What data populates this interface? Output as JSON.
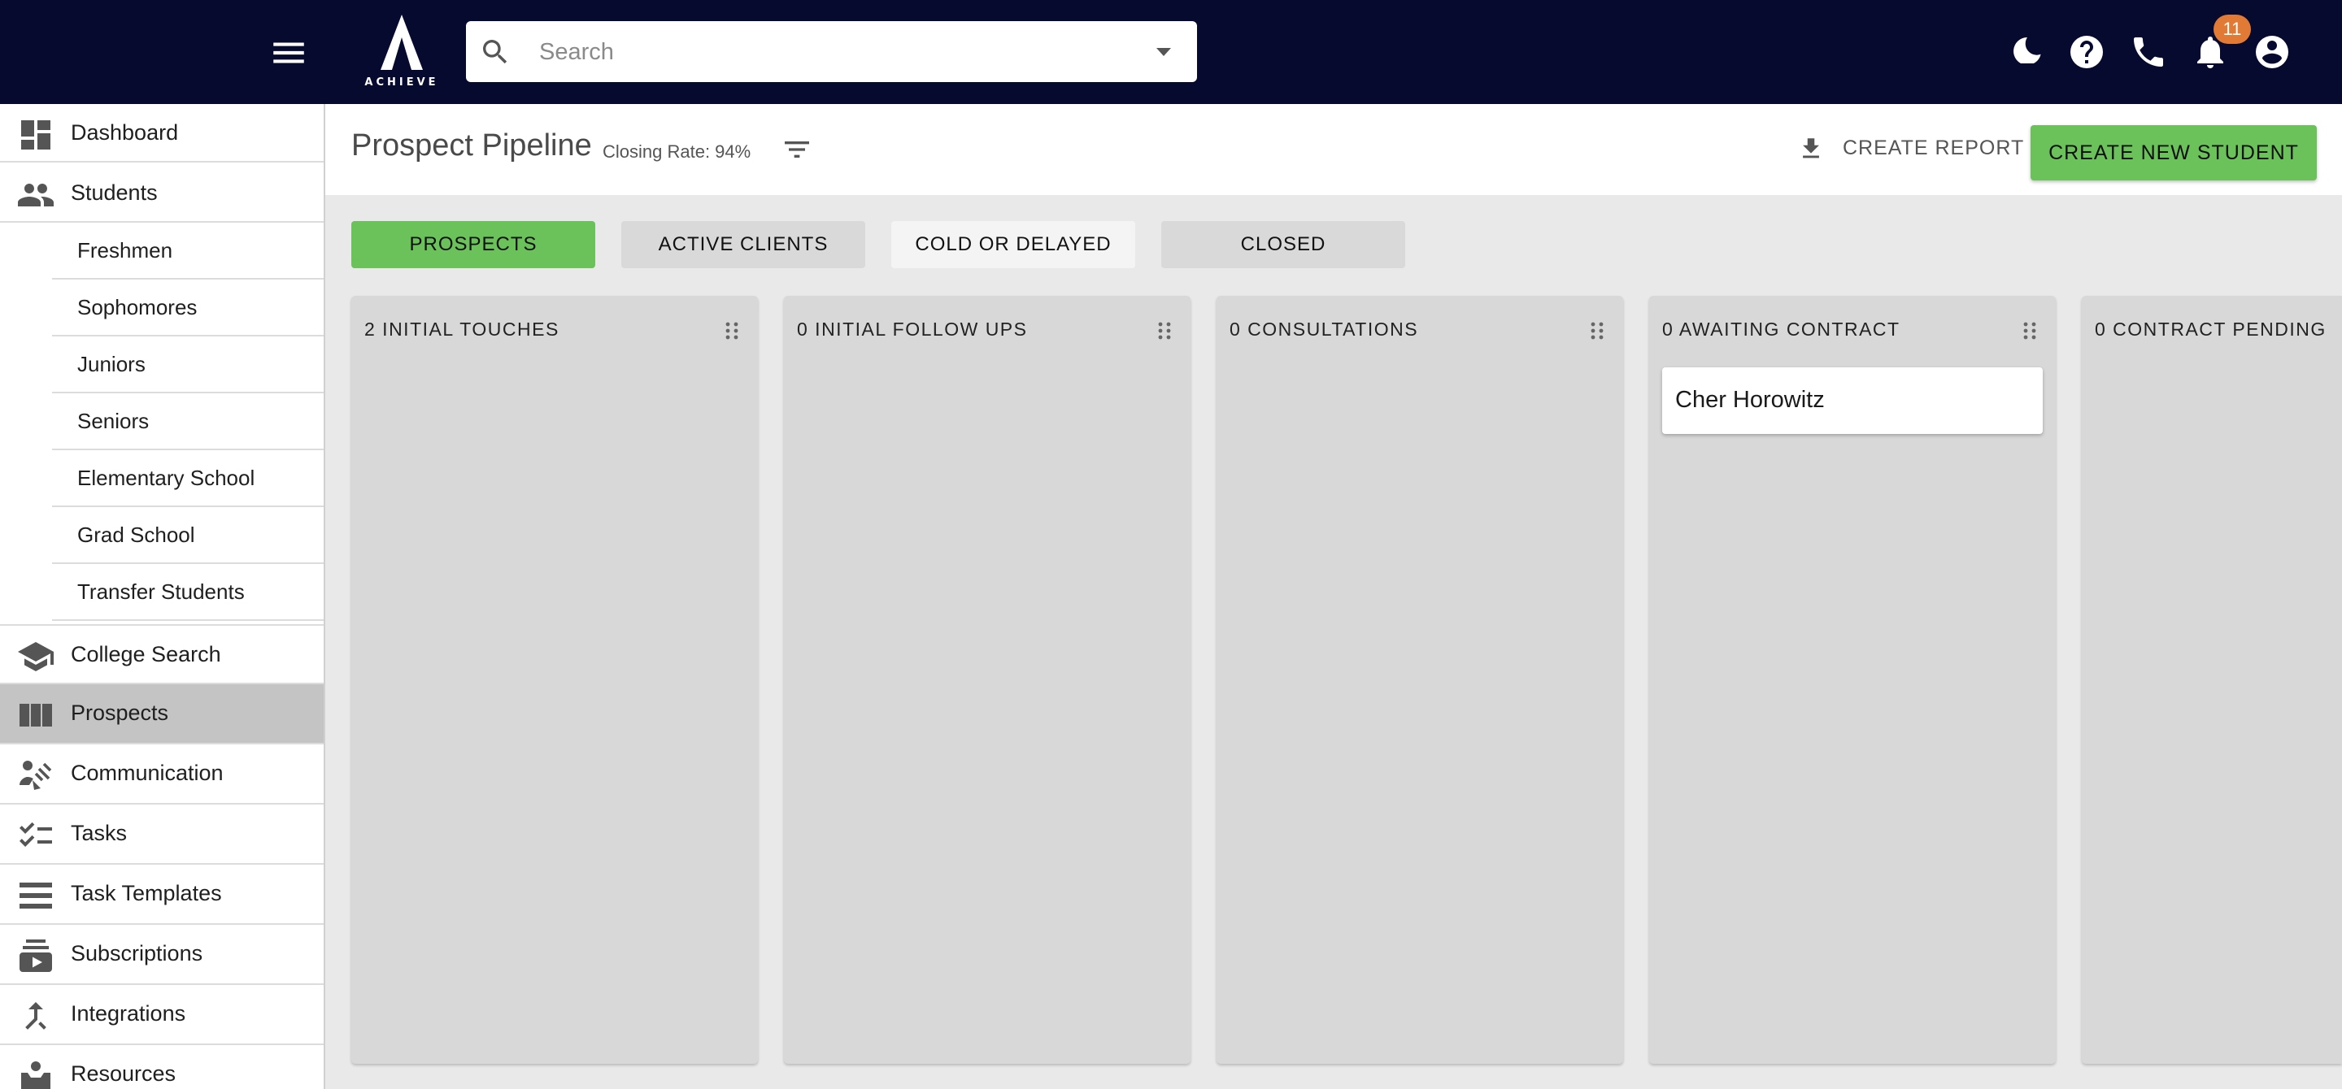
{
  "topbar": {
    "logo_text": "ACHIEVE",
    "search": {
      "placeholder": "Search",
      "value": ""
    },
    "notifications": {
      "count": "11"
    },
    "icons": [
      "menu-icon",
      "moon-icon",
      "help-icon",
      "phone-icon",
      "bell-icon",
      "account-icon"
    ],
    "colors": {
      "background": "#070a2f",
      "badge": "#e07a35"
    }
  },
  "sidebar": {
    "dashboard": "Dashboard",
    "students": "Students",
    "student_groups": [
      "Freshmen",
      "Sophomores",
      "Juniors",
      "Seniors",
      "Elementary School",
      "Grad School",
      "Transfer Students"
    ],
    "college_search": "College Search",
    "prospects": "Prospects",
    "communication": "Communication",
    "tasks": "Tasks",
    "task_templates": "Task Templates",
    "subscriptions": "Subscriptions",
    "integrations": "Integrations",
    "resources": "Resources",
    "active_item": "Prospects"
  },
  "header": {
    "title": "Prospect Pipeline",
    "closing_rate": "Closing Rate: 94%",
    "create_report": "CREATE REPORT",
    "create_student": "CREATE NEW STUDENT"
  },
  "tabs": [
    "PROSPECTS",
    "ACTIVE CLIENTS",
    "COLD OR DELAYED",
    "CLOSED"
  ],
  "active_tab": "PROSPECTS",
  "columns": [
    {
      "title": "2 INITIAL TOUCHES",
      "cards": []
    },
    {
      "title": "0 INITIAL FOLLOW UPS",
      "cards": []
    },
    {
      "title": "0 CONSULTATIONS",
      "cards": []
    },
    {
      "title": "0 AWAITING CONTRACT",
      "cards": [
        "Cher Horowitz"
      ]
    },
    {
      "title": "0 CONTRACT PENDING",
      "cards": []
    }
  ],
  "colors": {
    "accent": "#6cc25a",
    "column_bg": "#d8d8d8",
    "active_nav": "#c4c4c4"
  }
}
